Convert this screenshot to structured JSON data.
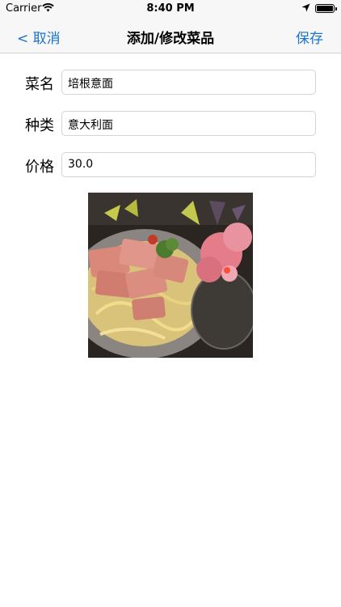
{
  "status_bar": {
    "carrier": "Carrier",
    "time": "8:40 PM",
    "battery_level": 1.0
  },
  "nav": {
    "back_label": "< 取消",
    "title": "添加/修改菜品",
    "save_label": "保存"
  },
  "form": {
    "fields": [
      {
        "label": "菜名",
        "value": "培根意面"
      },
      {
        "label": "种类",
        "value": "意大利面"
      },
      {
        "label": "价格",
        "value": "30.0"
      }
    ]
  },
  "colors": {
    "accent": "#1a73c9",
    "bar_background": "#f7f7f7"
  }
}
